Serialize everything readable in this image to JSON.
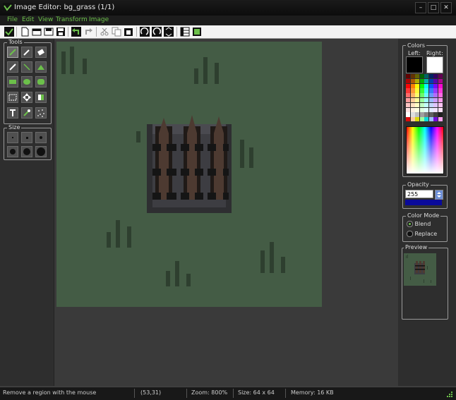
{
  "window": {
    "title": "Image Editor: bg_grass (1/1)"
  },
  "menu": [
    "File",
    "Edit",
    "View",
    "Transform",
    "Image"
  ],
  "toolbar_icons": [
    "checkmark-icon",
    "new-file-icon",
    "open-icon",
    "save-all-icon",
    "save-icon",
    "undo-icon",
    "redo-icon",
    "cut-icon",
    "copy-icon",
    "paste-icon",
    "rotate-left-icon",
    "rotate-right-icon",
    "flip-icon",
    "grid-icon",
    "image-icon"
  ],
  "tools": {
    "label": "Tools",
    "items": [
      "select-icon",
      "eyedropper-icon",
      "eraser-icon",
      "pencil-icon",
      "line-icon",
      "fill-icon",
      "rectangle-icon",
      "ellipse-icon",
      "rounded-rect-icon",
      "rect-select-icon",
      "move-icon",
      "paint-bucket-icon",
      "text-icon",
      "magic-wand-icon",
      "spray-icon"
    ]
  },
  "size": {
    "label": "Size"
  },
  "colors": {
    "label": "Colors",
    "left_label": "Left:",
    "right_label": "Right:",
    "left_color": "#000000",
    "right_color": "#ffffff"
  },
  "opacity": {
    "label": "Opacity",
    "value": "255"
  },
  "color_mode": {
    "label": "Color Mode",
    "options": [
      "Blend",
      "Replace"
    ],
    "selected": "Blend"
  },
  "preview": {
    "label": "Preview"
  },
  "status": {
    "hint": "Remove a region with the mouse",
    "coords": "(53,31)",
    "zoom": "Zoom: 800%",
    "size": "Size: 64 x 64",
    "memory": "Memory: 16 KB"
  },
  "accent_color": "#6cc04a",
  "canvas_color": "#445c45"
}
